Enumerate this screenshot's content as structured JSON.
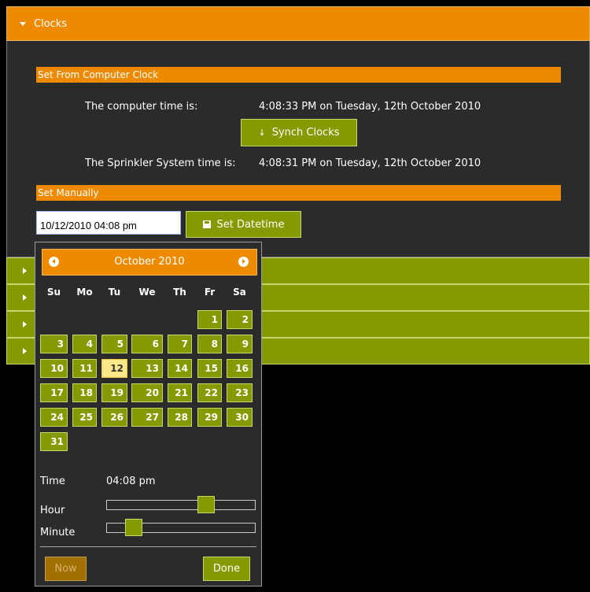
{
  "accordion": {
    "clocks": {
      "title": "Clocks",
      "set_from_computer": "Set From Computer Clock",
      "computer_time_label": "The computer time is:",
      "computer_time_value": "4:08:33 PM on Tuesday, 12th October 2010",
      "synch_button": "Synch Clocks",
      "sprinkler_time_label": "The Sprinkler System time is:",
      "sprinkler_time_value": "4:08:31 PM on Tuesday, 12th October 2010",
      "set_manually": "Set Manually",
      "datetime_input_value": "10/12/2010 04:08 pm",
      "set_datetime_button": "Set Datetime"
    },
    "collapsed_sections": 4
  },
  "datepicker": {
    "title": "October 2010",
    "weekdays": [
      "Su",
      "Mo",
      "Tu",
      "We",
      "Th",
      "Fr",
      "Sa"
    ],
    "days": [
      "1",
      "2",
      "3",
      "4",
      "5",
      "6",
      "7",
      "8",
      "9",
      "10",
      "11",
      "12",
      "13",
      "14",
      "15",
      "16",
      "17",
      "18",
      "19",
      "20",
      "21",
      "22",
      "23",
      "24",
      "25",
      "26",
      "27",
      "28",
      "29",
      "30",
      "31"
    ],
    "selected_day": "12",
    "time_label": "Time",
    "time_value": "04:08 pm",
    "hour_label": "Hour",
    "minute_label": "Minute",
    "hour_value": 16,
    "minute_value": 8,
    "now_button": "Now",
    "done_button": "Done"
  },
  "colors": {
    "orange": "#ee8a00",
    "green": "#859a00",
    "panel": "#2b2b2b",
    "today": "#fde88a"
  }
}
